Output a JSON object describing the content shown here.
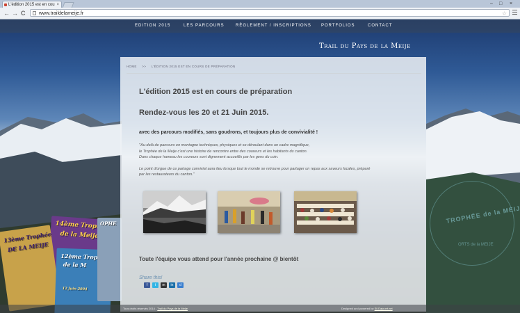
{
  "browser": {
    "tab_title": "L'édition 2015 est en cou",
    "tab_close": "×",
    "url": "www.traildelameije.fr",
    "back": "←",
    "forward": "→",
    "reload": "C",
    "star": "☆",
    "minimize": "–",
    "maximize": "□",
    "close": "×"
  },
  "site": {
    "nav": [
      "EDITION 2015",
      "LES PARCOURS",
      "RÈGLEMENT / INSCRIPTIONS",
      "PORTFOLIOS",
      "CONTACT"
    ],
    "brand": "Trail du Pays de la Meije"
  },
  "content": {
    "breadcrumb": {
      "home": "HOME",
      "separator": ">>",
      "current": "L'ÉDITION 2015 EST EN COURS DE PRÉPARATION"
    },
    "title": "L'édition 2015 est en cours de préparation",
    "dates": "Rendez-vous les 20 et 21 Juin 2015.",
    "tagline": "avec des parcours modifiés, sans goudrons, et toujours plus de convivialité !",
    "quote_p1_l1": "\"Au-delà de parcours en montagne techniques, physiques et se déroulant dans un cadre magnifique,",
    "quote_p1_l2": "le Trophée de la Meije c'est une histoire de rencontre entre des coureurs et les habitants du canton.",
    "quote_p1_l3": "Dans chaque hameau les coureurs sont dignement accueillis par les gens du coin.",
    "quote_p2_l1": "Le point d'orgue de ce partage convivial aura lieu lorsque tout le monde se retrouve pour partager un repas aux saveurs locales, préparé",
    "quote_p2_l2": "par les restaurateurs du canton.\"",
    "closing": "Toute l'équipe vous attend pour l'année prochaine @ bientôt",
    "share_label": "Share this!",
    "social_icons": [
      "facebook-icon",
      "twitter-icon",
      "myspace-icon",
      "linkedin-icon",
      "delicious-icon"
    ]
  },
  "posters": {
    "p1": "14ème Trophée",
    "p1b": "de la Meije",
    "p2": "13ème Trophée",
    "p2b": "DE LA MEIJE",
    "p3": "12ème Trop",
    "p3b": "de la M",
    "p3c": "12 Juin 2004",
    "p4": "OPHE",
    "roundel": "TROPHÉE de la MEIJE",
    "roundel2": "ORTS de la MEIJE"
  },
  "footer": {
    "left": "Tous droits réservés 2014 -",
    "left_link": "Trail du Pays de la Meije",
    "right": "Designed and powered by",
    "right_link": "Sil.Dajount.net"
  }
}
